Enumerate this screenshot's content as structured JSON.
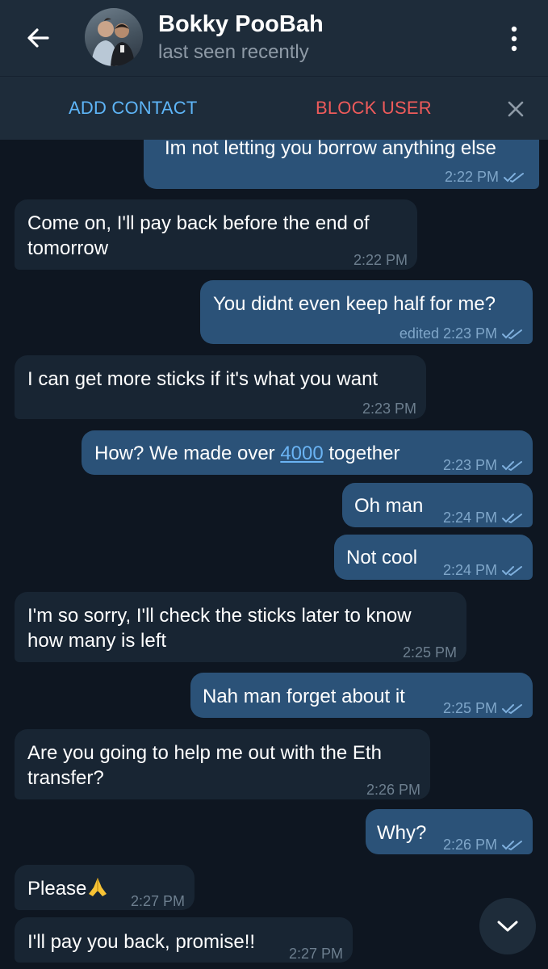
{
  "header": {
    "contact_name": "Bokky PooBah",
    "status": "last seen recently"
  },
  "action_bar": {
    "add_contact": "ADD CONTACT",
    "block_user": "BLOCK USER"
  },
  "colors": {
    "header_bg": "#1e2c3a",
    "chat_bg": "#0e1621",
    "outgoing_bubble": "#2b5278",
    "incoming_bubble": "#182533",
    "add_contact_blue": "#5eb5f7",
    "block_user_red": "#ef5b5b"
  },
  "icons": [
    "back-arrow-icon",
    "more-vert-icon",
    "close-icon",
    "double-check-icon",
    "chevron-down-icon",
    "folded-hands-emoji"
  ],
  "messages": [
    {
      "direction": "out",
      "text": "Im not letting you borrow anything else",
      "time": "2:22 PM",
      "read": true
    },
    {
      "direction": "in",
      "lines": [
        "Come on, I'll pay back before the end of",
        "tomorrow"
      ],
      "time": "2:22 PM"
    },
    {
      "direction": "out",
      "text": "You didnt even keep half for me?",
      "time": "edited 2:23 PM",
      "read": true
    },
    {
      "direction": "in",
      "text": "I can get more sticks if it's what you want",
      "time": "2:23 PM"
    },
    {
      "direction": "out",
      "text_before": "How? We made over ",
      "link": "4000",
      "text_after": " together",
      "time": "2:23 PM",
      "read": true
    },
    {
      "direction": "out",
      "text": "Oh man",
      "time": "2:24 PM",
      "read": true
    },
    {
      "direction": "out",
      "text": "Not cool",
      "time": "2:24 PM",
      "read": true
    },
    {
      "direction": "in",
      "lines": [
        "I'm so sorry, I'll check the sticks later to know",
        "how many is left"
      ],
      "time": "2:25 PM"
    },
    {
      "direction": "out",
      "text": "Nah man forget about it",
      "time": "2:25 PM",
      "read": true
    },
    {
      "direction": "in",
      "lines": [
        "Are you going to help me out with the Eth",
        "transfer?"
      ],
      "time": "2:26 PM"
    },
    {
      "direction": "out",
      "text": "Why?",
      "time": "2:26 PM",
      "read": true
    },
    {
      "direction": "in",
      "text": "Please",
      "emoji": "folded-hands",
      "time": "2:27 PM"
    },
    {
      "direction": "in",
      "text": "I'll pay you back, promise!!",
      "time": "2:27 PM"
    }
  ]
}
